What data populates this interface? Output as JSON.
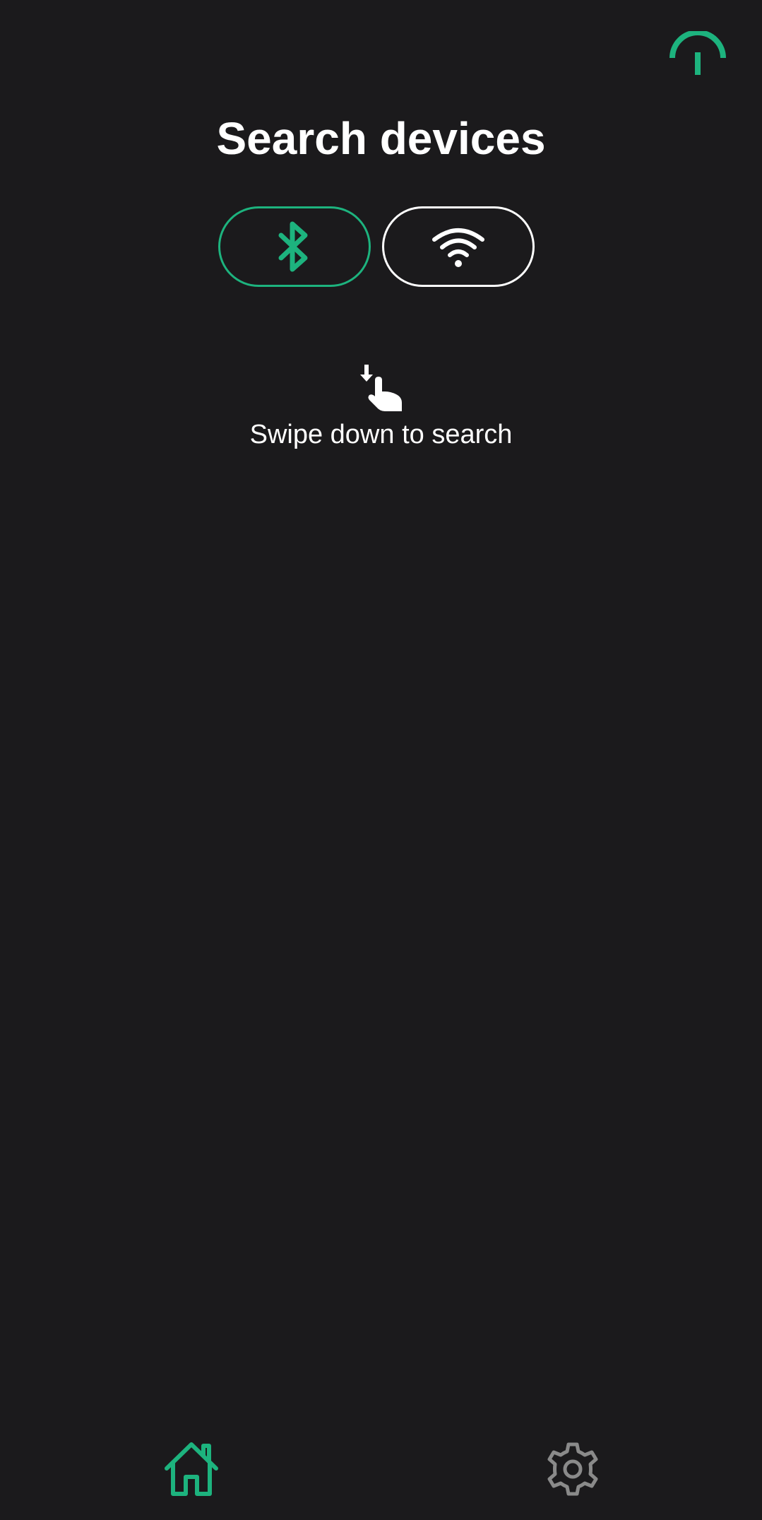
{
  "header": {
    "title": "Search devices",
    "status_icon": "signal-gauge-icon"
  },
  "connection_toggle": {
    "selected": "bluetooth",
    "options": [
      {
        "id": "bluetooth",
        "icon": "bluetooth-icon",
        "active": true
      },
      {
        "id": "wifi",
        "icon": "wifi-icon",
        "active": false
      }
    ]
  },
  "hint": {
    "icon": "swipe-down-hand-icon",
    "text": "Swipe down to search"
  },
  "bottom_nav": {
    "items": [
      {
        "id": "home",
        "icon": "home-icon",
        "active": true
      },
      {
        "id": "settings",
        "icon": "gear-icon",
        "active": false
      }
    ]
  },
  "colors": {
    "background": "#1b1a1c",
    "accent": "#1db37e",
    "text": "#ffffff",
    "inactive_icon": "#8a8a8a"
  }
}
